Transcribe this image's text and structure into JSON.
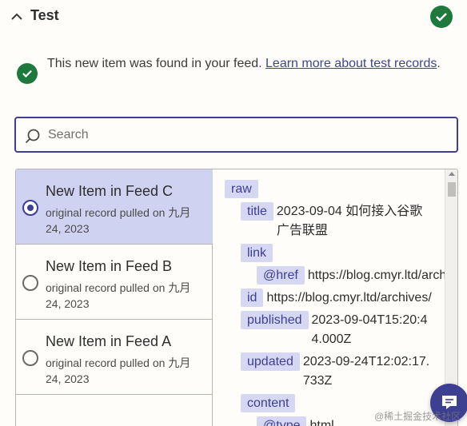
{
  "header": {
    "title": "Test",
    "chevron_icon": "chevron-up-icon",
    "status_icon": "check-circle-icon",
    "status_color": "#1e7a3c"
  },
  "info": {
    "message": "This new item was found in your feed. ",
    "link_text": "Learn more about test records",
    "suffix": "."
  },
  "search": {
    "placeholder": "Search",
    "value": ""
  },
  "records": [
    {
      "title": "New Item in Feed C",
      "subtitle": "original record pulled on 九月 24, 2023",
      "selected": true
    },
    {
      "title": "New Item in Feed B",
      "subtitle": "original record pulled on 九月 24, 2023",
      "selected": false
    },
    {
      "title": "New Item in Feed A",
      "subtitle": "original record pulled on 九月 24, 2023",
      "selected": false
    }
  ],
  "details": {
    "raw": "raw",
    "title_key": "title",
    "title_val": "2023-09-04 如何接入谷歌广告联盟",
    "link_key": "link",
    "href_key": "@href",
    "href_val": "https://blog.cmyr.ltd/archives/",
    "id_key": "id",
    "id_val": "https://blog.cmyr.ltd/archives/",
    "published_key": "published",
    "published_val": "2023-09-04T15:20:44.000Z",
    "updated_key": "updated",
    "updated_val": "2023-09-24T12:02:17.733Z",
    "content_key": "content",
    "type_key": "@type",
    "type_val": "html"
  },
  "colors": {
    "accent": "#3d3f91",
    "selected_bg": "#d0d2f2",
    "key_bg": "#d6d8f3",
    "page_bg": "#fffdf9"
  },
  "chat": {
    "icon": "chat-icon"
  },
  "watermark": "@稀土掘金技术社区"
}
